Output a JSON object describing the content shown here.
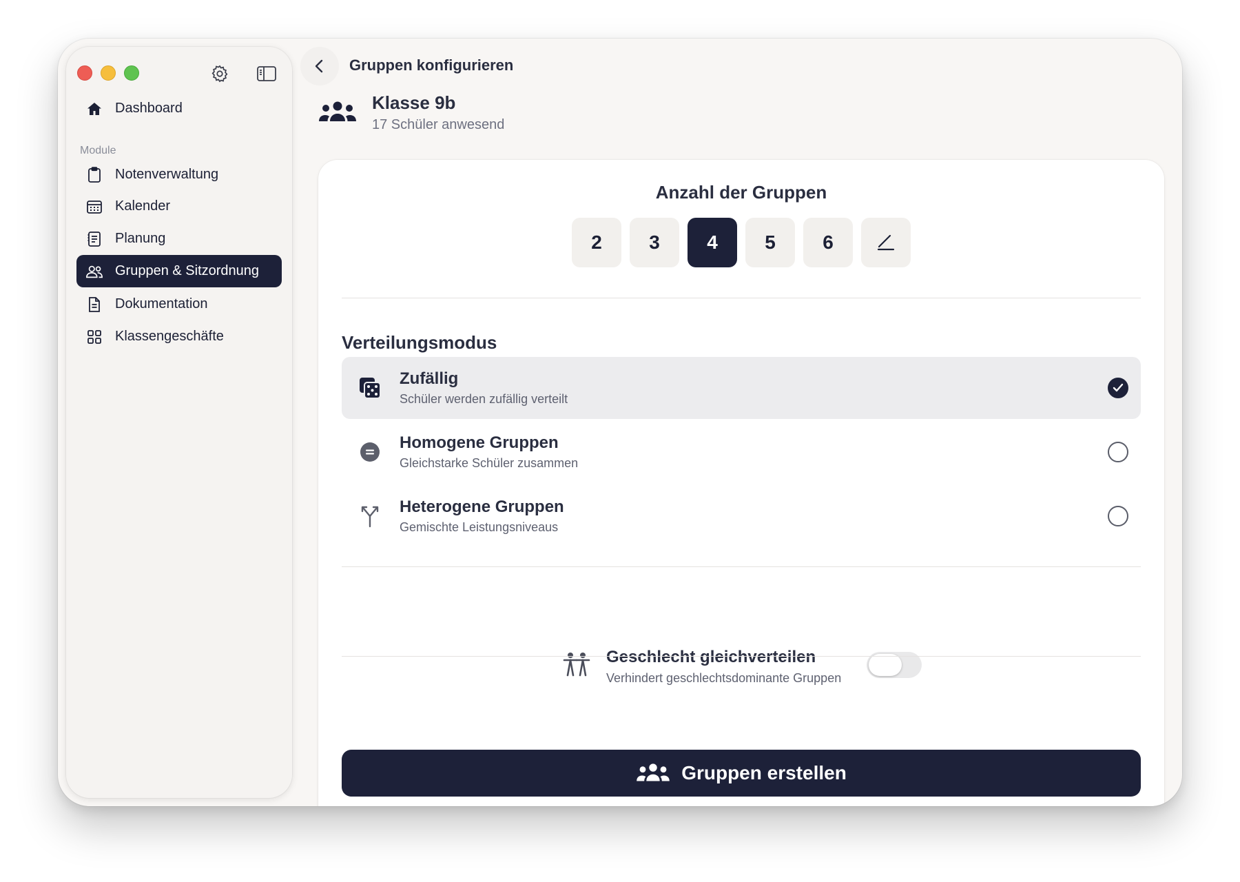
{
  "colors": {
    "accent": "#1d2139",
    "window_bg": "#f8f6f4",
    "card_bg": "#ffffff",
    "close": "#ee5d55",
    "minimize": "#f6be3c",
    "maximize": "#5fc350"
  },
  "window": {
    "title": "Gruppen konfigurieren"
  },
  "sidebar": {
    "dashboard": {
      "label": "Dashboard",
      "icon": "house-icon"
    },
    "section_label": "Module",
    "items": [
      {
        "label": "Notenverwaltung",
        "icon": "clipboard-icon"
      },
      {
        "label": "Kalender",
        "icon": "calendar-icon"
      },
      {
        "label": "Planung",
        "icon": "notes-icon"
      },
      {
        "label": "Gruppen & Sitzordnung",
        "icon": "people-icon",
        "active": true
      },
      {
        "label": "Dokumentation",
        "icon": "document-icon"
      },
      {
        "label": "Klassengeschäfte",
        "icon": "grid-icon"
      }
    ]
  },
  "class_info": {
    "name": "Klasse 9b",
    "subtitle": "17 Schüler anwesend"
  },
  "group_count": {
    "title": "Anzahl der Gruppen",
    "options": [
      "2",
      "3",
      "4",
      "5",
      "6"
    ],
    "selected": "4",
    "custom_icon": "pencil-icon"
  },
  "distribution": {
    "title": "Verteilungsmodus",
    "modes": [
      {
        "label": "Zufällig",
        "description": "Schüler werden zufällig verteilt",
        "icon": "dice-icon",
        "selected": true
      },
      {
        "label": "Homogene Gruppen",
        "description": "Gleichstarke Schüler zusammen",
        "icon": "equal-circle-icon",
        "selected": false
      },
      {
        "label": "Heterogene Gruppen",
        "description": "Gemischte Leistungsniveaus",
        "icon": "branch-icon",
        "selected": false
      }
    ]
  },
  "gender": {
    "label": "Geschlecht gleichverteilen",
    "description": "Verhindert geschlechtsdominante Gruppen",
    "enabled": false
  },
  "create_button": {
    "label": "Gruppen erstellen"
  }
}
